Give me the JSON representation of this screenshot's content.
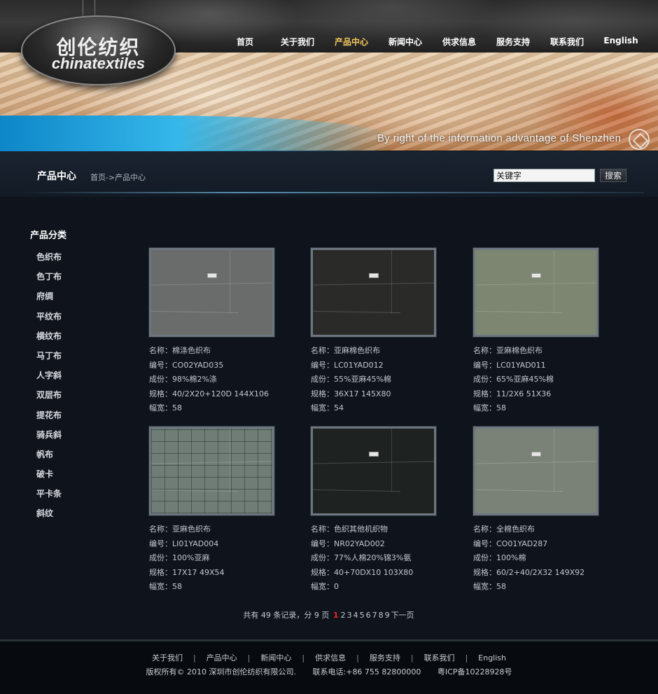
{
  "brand": {
    "logo_cn": "创伦纺织",
    "logo_en": "chinatextiles",
    "slogan": "By right of the information advantage of Shenzhen"
  },
  "nav": [
    {
      "label": "首页"
    },
    {
      "label": "关于我们"
    },
    {
      "label": "产品中心",
      "active": true
    },
    {
      "label": "新闻中心"
    },
    {
      "label": "供求信息"
    },
    {
      "label": "服务支持"
    },
    {
      "label": "联系我们"
    },
    {
      "label": "English"
    }
  ],
  "page": {
    "title": "产品中心",
    "breadcrumb": "首页->产品中心"
  },
  "search": {
    "value": "关键字",
    "button": "搜索"
  },
  "sidebar": {
    "title": "产品分类",
    "items": [
      {
        "label": "色织布"
      },
      {
        "label": "色丁布"
      },
      {
        "label": "府绸"
      },
      {
        "label": "平纹布"
      },
      {
        "label": "横纹布"
      },
      {
        "label": "马丁布"
      },
      {
        "label": "人字斜"
      },
      {
        "label": "双层布"
      },
      {
        "label": "提花布"
      },
      {
        "label": "骑兵斜"
      },
      {
        "label": "帆布"
      },
      {
        "label": "破卡"
      },
      {
        "label": "平卡条"
      },
      {
        "label": "斜纹"
      }
    ]
  },
  "products": [
    {
      "name": "名称：棉涤色织布",
      "code": "编号：CO02YAD035",
      "composition": "成份：98%棉2%涤",
      "spec": "规格：40/2X20+120D 144X106",
      "width": "幅宽：58",
      "swatch_color": "#6a6c6c",
      "pattern": "plain"
    },
    {
      "name": "名称：亚麻棉色织布",
      "code": "编号：LC01YAD012",
      "composition": "成份：55%亚麻45%棉",
      "spec": "规格：36X17 145X80",
      "width": "幅宽：54",
      "swatch_color": "#2a2b28",
      "pattern": "plain"
    },
    {
      "name": "名称：亚麻棉色织布",
      "code": "编号：LC01YAD011",
      "composition": "成份：65%亚麻45%棉",
      "spec": "规格：11/2X6 51X36",
      "width": "幅宽：58",
      "swatch_color": "#7c8670",
      "pattern": "plain"
    },
    {
      "name": "名称：亚麻色织布",
      "code": "编号：LI01YAD004",
      "composition": "成份：100%亚麻",
      "spec": "规格：17X17 49X54",
      "width": "幅宽：58",
      "swatch_color": "#6f7d76",
      "pattern": "grid"
    },
    {
      "name": "名称：色织其他机织物",
      "code": "编号：NR02YAD002",
      "composition": "成份：77%人棉20%锦3%氨",
      "spec": "规格：40+70DX10 103X80",
      "width": "幅宽：0",
      "swatch_color": "#1e2220",
      "pattern": "plain"
    },
    {
      "name": "名称：全棉色织布",
      "code": "编号：CO01YAD287",
      "composition": "成份：100%棉",
      "spec": "规格：60/2+40/2X32 149X92",
      "width": "幅宽：58",
      "swatch_color": "#7a8278",
      "pattern": "plain"
    }
  ],
  "pagination": {
    "summary": "共有 49 条记录，分 9 页",
    "current": "1",
    "pages": [
      "2",
      "3",
      "4",
      "5",
      "6",
      "7",
      "8",
      "9"
    ],
    "next": "下一页"
  },
  "footer": {
    "links": [
      {
        "label": "关于我们"
      },
      {
        "label": "产品中心"
      },
      {
        "label": "新闻中心"
      },
      {
        "label": "供求信息"
      },
      {
        "label": "服务支持"
      },
      {
        "label": "联系我们"
      },
      {
        "label": "English"
      }
    ],
    "copyright": "版权所有© 2010 深圳市创伦纺织有限公司.",
    "phone": "联系电话:+86 755 82800000",
    "icp": "粤ICP备10228928号"
  }
}
